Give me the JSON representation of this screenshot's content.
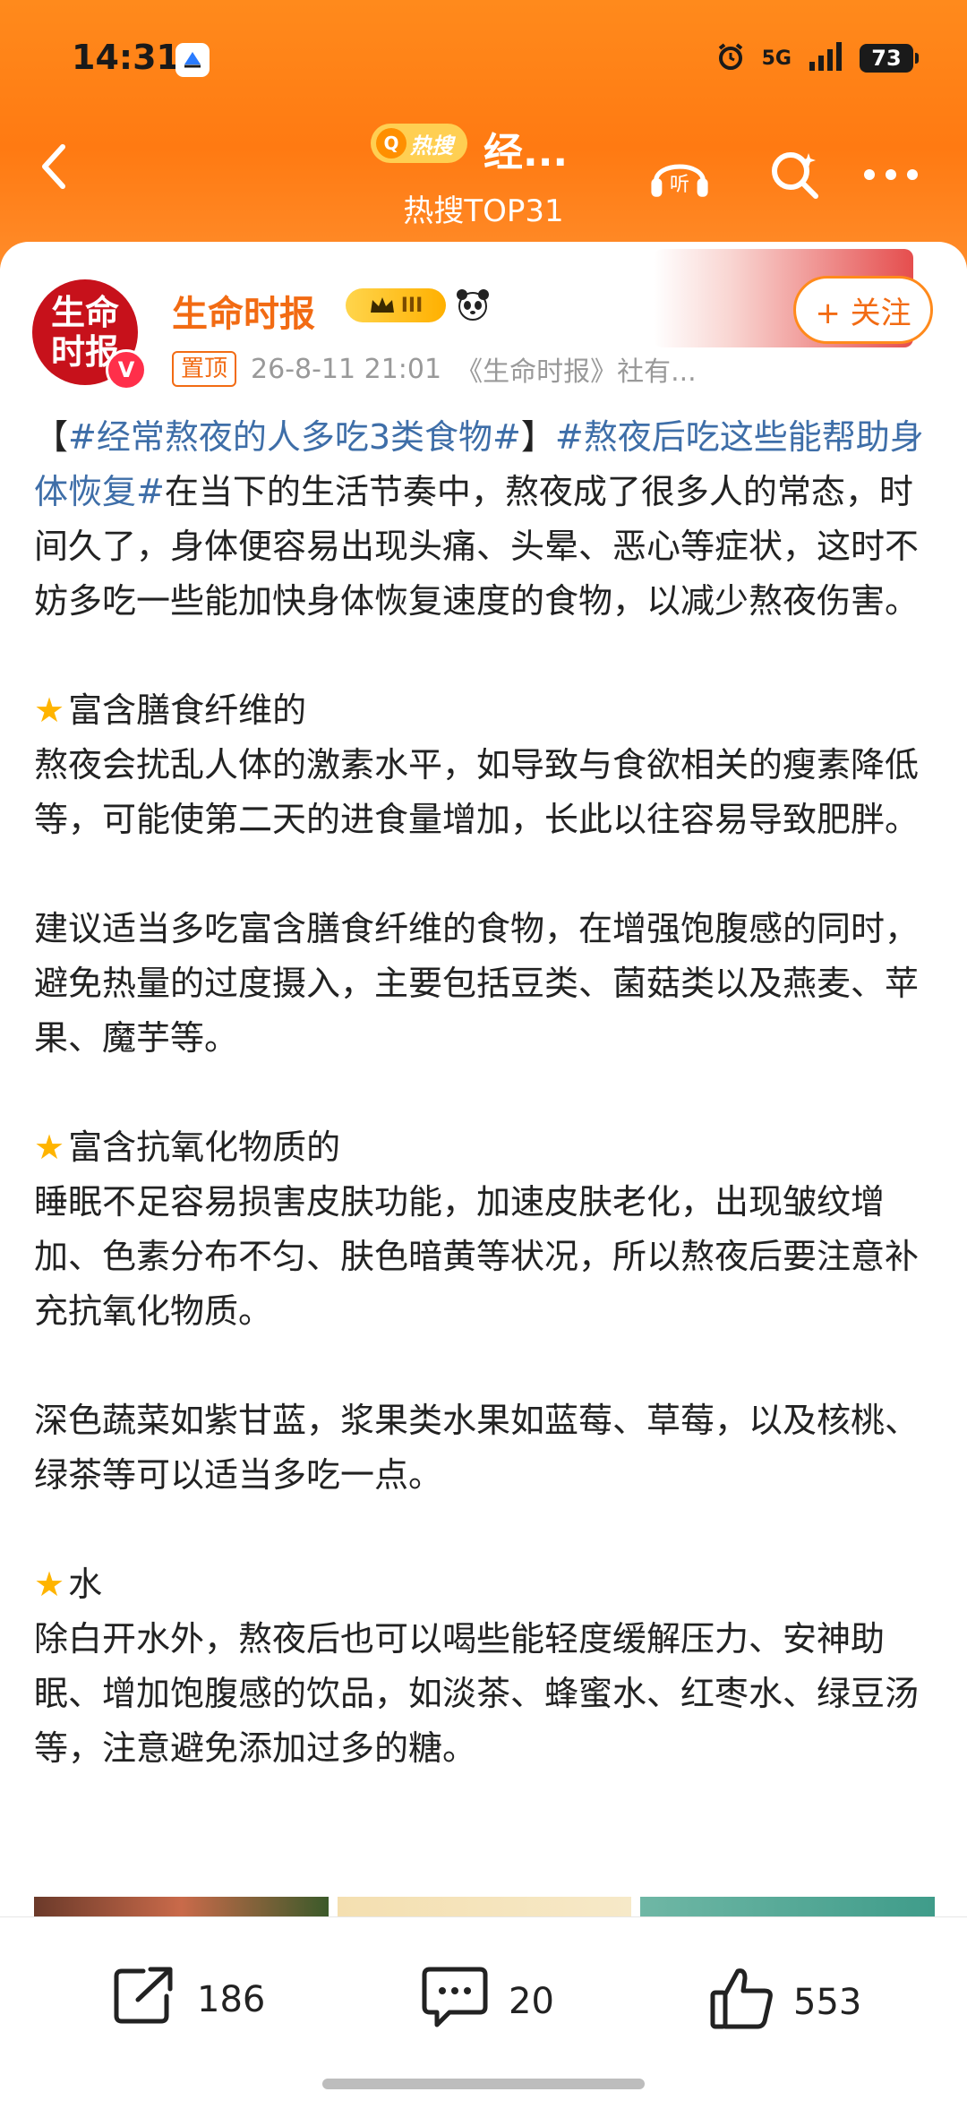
{
  "status": {
    "time": "14:31",
    "network": "5G",
    "battery": "73"
  },
  "nav": {
    "hot_label": "热搜",
    "title": "经...",
    "subtitle": "热搜TOP31",
    "listen_label": "听"
  },
  "post": {
    "avatar_text_line1": "生命",
    "avatar_text_line2": "时报",
    "verified_mark": "V",
    "author": "生命时报",
    "level_badge": "III",
    "follow_label": "+ 关注",
    "pinned_label": "置顶",
    "timestamp": "26-8-11 21:01",
    "source": "《生命时报》社有...",
    "intro_open": "【",
    "tag1": "#经常熬夜的人多吃3类食物#",
    "intro_close": "】",
    "tag2": "#熬夜后吃这些能帮助身体恢复#",
    "intro_text": "在当下的生活节奏中，熬夜成了很多人的常态，时间久了，身体便容易出现头痛、头晕、恶心等症状，这时不妨多吃一些能加快身体恢复速度的食物，以减少熬夜伤害。",
    "sections": [
      {
        "heading": "富含膳食纤维的",
        "paragraphs": [
          "熬夜会扰乱人体的激素水平，如导致与食欲相关的瘦素降低等，可能使第二天的进食量增加，长此以往容易导致肥胖。",
          "建议适当多吃富含膳食纤维的食物，在增强饱腹感的同时，避免热量的过度摄入，主要包括豆类、菌菇类以及燕麦、苹果、魔芋等。"
        ]
      },
      {
        "heading": "富含抗氧化物质的",
        "paragraphs": [
          "睡眠不足容易损害皮肤功能，加速皮肤老化，出现皱纹增加、色素分布不匀、肤色暗黄等状况，所以熬夜后要注意补充抗氧化物质。",
          "深色蔬菜如紫甘蓝，浆果类水果如蓝莓、草莓，以及核桃、绿茶等可以适当多吃一点。"
        ]
      },
      {
        "heading": "水",
        "paragraphs": [
          "除白开水外，熬夜后也可以喝些能轻度缓解压力、安神助眠、增加饱腹感的饮品，如淡茶、蜂蜜水、红枣水、绿豆汤等，注意避免添加过多的糖。"
        ]
      }
    ]
  },
  "actions": {
    "share_count": "186",
    "comment_count": "20",
    "like_count": "553"
  },
  "colors": {
    "header": "#ff7a12",
    "accent": "#f26b13",
    "hashtag": "#3e6ea8",
    "star": "#ffb400"
  },
  "icons": [
    "back-icon",
    "headphones-icon",
    "search-icon",
    "more-icon",
    "share-icon",
    "comment-icon",
    "like-icon",
    "star-icon",
    "crown-icon",
    "panda-icon"
  ]
}
